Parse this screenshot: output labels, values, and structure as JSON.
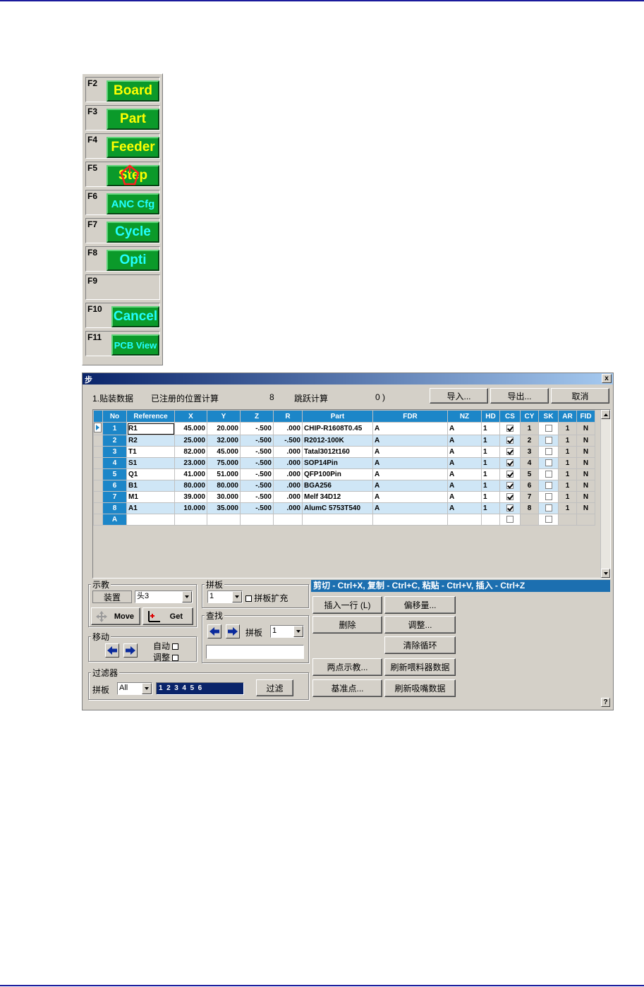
{
  "fkeys": [
    {
      "key": "F2",
      "label": "Board",
      "color": "yellow"
    },
    {
      "key": "F3",
      "label": "Part",
      "color": "yellow"
    },
    {
      "key": "F4",
      "label": "Feeder",
      "color": "yellow"
    },
    {
      "key": "F5",
      "label": "Step",
      "color": "yellow"
    },
    {
      "key": "F6",
      "label": "ANC Cfg",
      "color": "cyan"
    },
    {
      "key": "F7",
      "label": "Cycle",
      "color": "cyan"
    },
    {
      "key": "F8",
      "label": "Opti",
      "color": "cyan"
    },
    {
      "key": "F9",
      "label": "",
      "color": ""
    },
    {
      "key": "F10",
      "label": "Cancel",
      "color": "cyan"
    },
    {
      "key": "F11",
      "label": "PCB View",
      "color": "cyan"
    }
  ],
  "dialog": {
    "title": "步",
    "close": "x",
    "summary": {
      "data_label": "1.贴装数据",
      "registered_label": "已注册的位置计算",
      "registered_count": "8",
      "skip_label": "跳跃计算",
      "skip_count": "0 )"
    },
    "import_label": "导入...",
    "export_label": "导出...",
    "cancel_label": "取消",
    "columns": [
      "No",
      "Reference",
      "X",
      "Y",
      "Z",
      "R",
      "Part",
      "FDR",
      "NZ",
      "HD",
      "CS",
      "CY",
      "SK",
      "AR",
      "FID"
    ],
    "rows": [
      {
        "no": "1",
        "ref": "R1",
        "x": "45.000",
        "y": "20.000",
        "z": "-.500",
        "r": ".000",
        "part": "CHIP-R1608T0.45",
        "fdr": "A",
        "nz": "A",
        "hd": "1",
        "cs": true,
        "cy": "1",
        "sk": false,
        "ar": "1",
        "fid": "N"
      },
      {
        "no": "2",
        "ref": "R2",
        "x": "25.000",
        "y": "32.000",
        "z": "-.500",
        "r": "-.500",
        "part": "R2012-100K",
        "fdr": "A",
        "nz": "A",
        "hd": "1",
        "cs": true,
        "cy": "2",
        "sk": false,
        "ar": "1",
        "fid": "N"
      },
      {
        "no": "3",
        "ref": "T1",
        "x": "82.000",
        "y": "45.000",
        "z": "-.500",
        "r": ".000",
        "part": "Tatal3012t160",
        "fdr": "A",
        "nz": "A",
        "hd": "1",
        "cs": true,
        "cy": "3",
        "sk": false,
        "ar": "1",
        "fid": "N"
      },
      {
        "no": "4",
        "ref": "S1",
        "x": "23.000",
        "y": "75.000",
        "z": "-.500",
        "r": ".000",
        "part": "SOP14Pin",
        "fdr": "A",
        "nz": "A",
        "hd": "1",
        "cs": true,
        "cy": "4",
        "sk": false,
        "ar": "1",
        "fid": "N"
      },
      {
        "no": "5",
        "ref": "Q1",
        "x": "41.000",
        "y": "51.000",
        "z": "-.500",
        "r": ".000",
        "part": "QFP100Pin",
        "fdr": "A",
        "nz": "A",
        "hd": "1",
        "cs": true,
        "cy": "5",
        "sk": false,
        "ar": "1",
        "fid": "N"
      },
      {
        "no": "6",
        "ref": "B1",
        "x": "80.000",
        "y": "80.000",
        "z": "-.500",
        "r": ".000",
        "part": "BGA256",
        "fdr": "A",
        "nz": "A",
        "hd": "1",
        "cs": true,
        "cy": "6",
        "sk": false,
        "ar": "1",
        "fid": "N"
      },
      {
        "no": "7",
        "ref": "M1",
        "x": "39.000",
        "y": "30.000",
        "z": "-.500",
        "r": ".000",
        "part": "Melf 34D12",
        "fdr": "A",
        "nz": "A",
        "hd": "1",
        "cs": true,
        "cy": "7",
        "sk": false,
        "ar": "1",
        "fid": "N"
      },
      {
        "no": "8",
        "ref": "A1",
        "x": "10.000",
        "y": "35.000",
        "z": "-.500",
        "r": ".000",
        "part": "AlumC 5753T540",
        "fdr": "A",
        "nz": "A",
        "hd": "1",
        "cs": true,
        "cy": "8",
        "sk": false,
        "ar": "1",
        "fid": "N"
      }
    ],
    "new_row_no": "A",
    "teach": {
      "group_label": "示教",
      "device_label": "装置",
      "device_value": "头3",
      "move_label": "Move",
      "get_label": "Get"
    },
    "panel": {
      "group_label": "拼板",
      "value": "1",
      "expand_label": "拼板扩充"
    },
    "find": {
      "group_label": "查找",
      "panel_label": "拼板",
      "panel_value": "1",
      "text_value": ""
    },
    "move": {
      "group_label": "移动",
      "auto_label": "自动",
      "adjust_label": "调整"
    },
    "filter": {
      "group_label": "过滤器",
      "panel_label": "拼板",
      "panel_value": "All",
      "panels_text": "1  2  3  4  5  6",
      "filter_button": "过滤"
    },
    "hint": "剪切 - Ctrl+X, 复制 - Ctrl+C, 粘贴 - Ctrl+V, 插入 - Ctrl+Z",
    "buttons": {
      "insert_row": "插入一行 (L)",
      "offset": "偏移量...",
      "delete": "删除",
      "adjust": "调整...",
      "clear_cycle": "清除循环",
      "two_point": "两点示教...",
      "refresh_feeder": "刷新喂料器数据",
      "fiducial": "基准点...",
      "refresh_nozzle": "刷新吸嘴数据"
    },
    "help": "?"
  },
  "colors": {
    "green_button": "#0b9a2a",
    "yellow_text": "#ffff00",
    "cyan_text": "#22ffff",
    "header_blue": "#1c86c8",
    "alt_row": "#cfe6f6"
  }
}
